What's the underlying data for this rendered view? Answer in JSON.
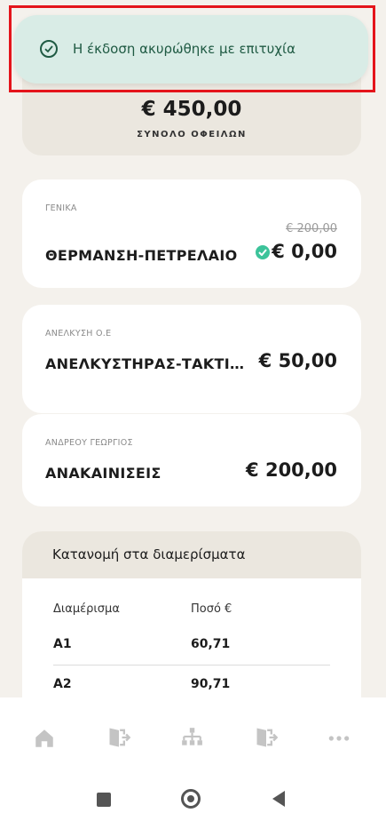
{
  "toast": {
    "message": "Η έκδοση ακυρώθηκε με επιτυχία",
    "icon": "check-circle-icon",
    "color": "#1f5a43",
    "background": "#d9ece6"
  },
  "summary": {
    "total": "€ 450,00",
    "label": "ΣΥΝΟΛΟ ΟΦΕΙΛΩΝ"
  },
  "charges": [
    {
      "category": "ΓΕΝΙΚΑ",
      "name": "ΘΕΡΜΑΝΣΗ-ΠΕΤΡΕΛΑΙΟ",
      "old_amount": "€ 200,00",
      "amount": "€ 0,00",
      "paid_icon": "check-badge-icon"
    },
    {
      "category": "ΑΝΕΛΚΥΣΗ Ο.Ε",
      "name": "ΑΝΕΛΚΥΣΤΗΡΑΣ-ΤΑΚΤΙΚΗ...",
      "amount": "€ 50,00"
    },
    {
      "category": "ΑΝΔΡΕΟΥ ΓΕΩΡΓΙΟΣ",
      "name": "ΑΝΑΚΑΙΝΙΣΕΙΣ",
      "amount": "€ 200,00"
    }
  ],
  "distribution": {
    "title": "Κατανομή στα διαμερίσματα",
    "columns": [
      "Διαμέρισμα",
      "Ποσό €"
    ],
    "rows": [
      {
        "apartment": "Α1",
        "amount": "60,71"
      },
      {
        "apartment": "Α2",
        "amount": "90,71"
      }
    ]
  },
  "bottom_nav": {
    "items": [
      "home-icon",
      "exit-door-icon",
      "org-chart-icon",
      "exit-door-icon",
      "more-dots-icon"
    ],
    "icon_color": "#c4c4c4"
  },
  "system_nav": [
    "recent-apps-button",
    "home-button",
    "back-button"
  ]
}
